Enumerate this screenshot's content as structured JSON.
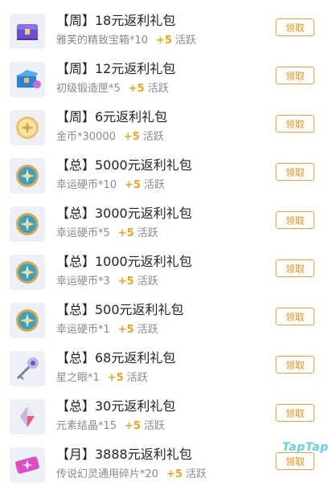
{
  "rewards": [
    {
      "icon": "purple-treasure-chest-icon",
      "title": "【周】18元返利礼包",
      "item": "雅芙的精致宝箱*10",
      "bonus": "+5",
      "bonus_label": "活跃",
      "button": "领取"
    },
    {
      "icon": "blue-forge-box-icon",
      "title": "【周】12元返利礼包",
      "item": "初级锻造匣*5",
      "bonus": "+5",
      "bonus_label": "活跃",
      "button": "领取"
    },
    {
      "icon": "gold-coin-icon",
      "title": "【周】6元返利礼包",
      "item": "金币*30000",
      "bonus": "+5",
      "bonus_label": "活跃",
      "button": "领取"
    },
    {
      "icon": "lucky-coin-icon",
      "title": "【总】5000元返利礼包",
      "item": "幸运硬币*10",
      "bonus": "+5",
      "bonus_label": "活跃",
      "button": "领取"
    },
    {
      "icon": "lucky-coin-icon",
      "title": "【总】3000元返利礼包",
      "item": "幸运硬币*5",
      "bonus": "+5",
      "bonus_label": "活跃",
      "button": "领取"
    },
    {
      "icon": "lucky-coin-icon",
      "title": "【总】1000元返利礼包",
      "item": "幸运硬币*3",
      "bonus": "+5",
      "bonus_label": "活跃",
      "button": "领取"
    },
    {
      "icon": "lucky-coin-icon",
      "title": "【总】500元返利礼包",
      "item": "幸运硬币*1",
      "bonus": "+5",
      "bonus_label": "活跃",
      "button": "领取"
    },
    {
      "icon": "star-eye-key-icon",
      "title": "【总】68元返利礼包",
      "item": "星之眼*1",
      "bonus": "+5",
      "bonus_label": "活跃",
      "button": "领取"
    },
    {
      "icon": "element-crystal-icon",
      "title": "【总】30元返利礼包",
      "item": "元素结晶*15",
      "bonus": "+5",
      "bonus_label": "活跃",
      "button": "领取"
    },
    {
      "icon": "phantom-ticket-icon",
      "title": "【月】3888元返利礼包",
      "item": "传说幻灵通用碎片*20",
      "bonus": "+5",
      "bonus_label": "活跃",
      "button": "领取"
    }
  ],
  "watermark": "TapTap",
  "colors": {
    "accent": "#f0901a",
    "button_border": "#f3a02c",
    "bonus": "#f5a21a",
    "watermark": "#5fd4e6"
  }
}
